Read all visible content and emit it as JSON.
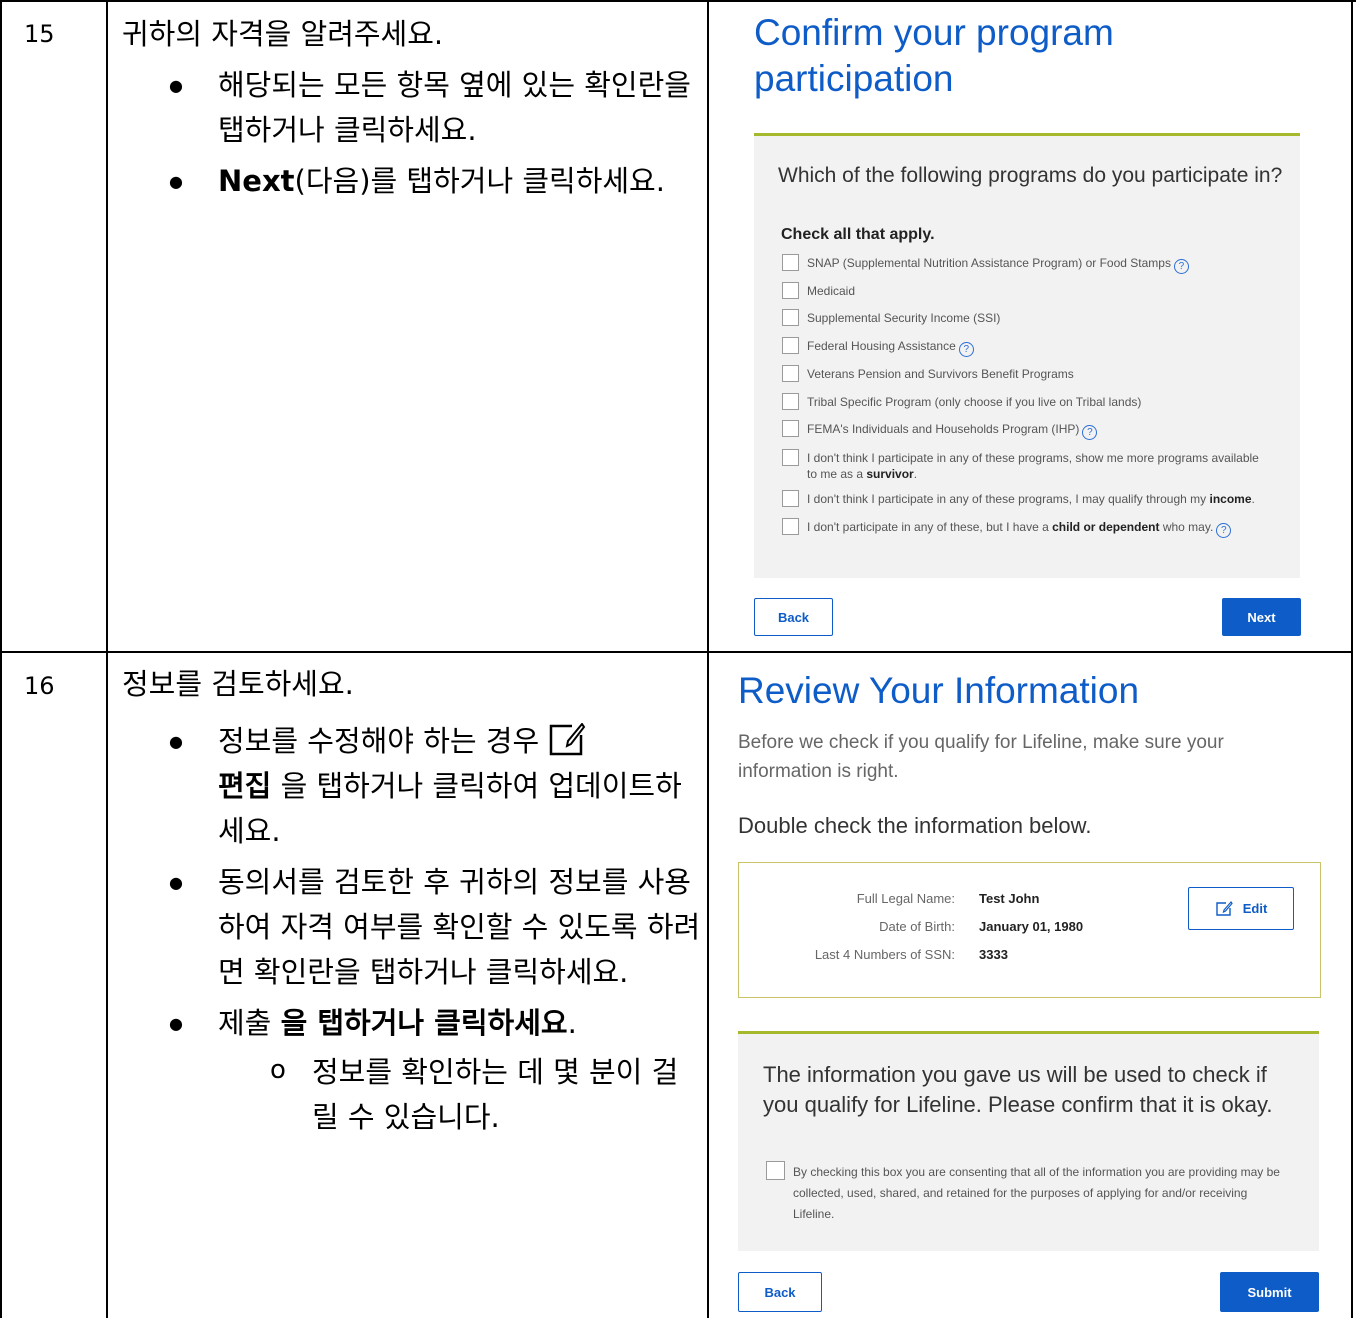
{
  "steps": [
    {
      "number": "15",
      "heading": "귀하의 자격을 알려주세요.",
      "bullet1": "해당되는 모든 항목 옆에 있는 확인란을 탭하거나 클릭하세요.",
      "bullet2_bold": "Next",
      "bullet2_rest": "(다음)를 탭하거나 클릭하세요."
    },
    {
      "number": "16",
      "heading": "정보를 검토하세요.",
      "bullet1_a": "정보를 수정해야 하는 경우",
      "bullet1_bold": "편집",
      "bullet1_b": "을 탭하거나 클릭하여 업데이트하세요.",
      "bullet2": "동의서를 검토한 후 귀하의 정보를 사용하여 자격 여부를 확인할 수 있도록 하려면 확인란을 탭하거나 클릭하세요.",
      "bullet3_a": "제출",
      "bullet3_bold": "을 탭하거나 클릭하세요",
      "bullet3_b": ".",
      "sub_bullet": "정보를 확인하는 데 몇 분이 걸릴 수 있습니다."
    }
  ],
  "screen1": {
    "title": "Confirm your program participation",
    "question": "Which of the following programs do you participate in?",
    "check_all": "Check all that apply.",
    "options": [
      {
        "text": "SNAP (Supplemental Nutrition Assistance Program) or Food Stamps",
        "help": "?"
      },
      {
        "text": "Medicaid"
      },
      {
        "text": "Supplemental Security Income (SSI)"
      },
      {
        "text": "Federal Housing Assistance",
        "help": "?"
      },
      {
        "text": "Veterans Pension and Survivors Benefit Programs"
      },
      {
        "text": "Tribal Specific Program (only choose if you live on Tribal lands)"
      },
      {
        "text": "FEMA's Individuals and Households Program (IHP)",
        "help": "?"
      }
    ],
    "opt_survivor_a": "I don't think I participate in any of these programs, show me more programs available to me as a",
    "opt_survivor_bold": "survivor",
    "opt_survivor_b": ".",
    "opt_income_a": "I don't think I participate in any of these programs, I may qualify through my",
    "opt_income_bold": "income",
    "opt_income_b": ".",
    "opt_child_a": "I don't participate in any of these, but I have a",
    "opt_child_bold": "child or dependent",
    "opt_child_b": "who may.",
    "help_glyph": "?",
    "back_label": "Back",
    "next_label": "Next"
  },
  "screen2": {
    "title": "Review Your Information",
    "subtitle": "Before we check if you qualify for Lifeline, make sure your information is right.",
    "double_check": "Double check the information below.",
    "fields": [
      {
        "label": "Full Legal Name:",
        "value": "Test John"
      },
      {
        "label": "Date of Birth:",
        "value": "January 01, 1980"
      },
      {
        "label": "Last 4 Numbers of SSN:",
        "value": "3333"
      }
    ],
    "edit_label": "Edit",
    "consent_heading": "The information you gave us will be used to check if you qualify for Lifeline. Please confirm that it is okay.",
    "consent_text": "By checking this box you are consenting that all of the information you are providing may be collected, used, shared, and retained for the purposes of applying for and/or receiving Lifeline.",
    "back_label": "Back",
    "submit_label": "Submit"
  },
  "colors": {
    "accent_blue": "#0e5cc7",
    "divider_green": "#a6b82b",
    "panel_gray": "#f2f2f2"
  }
}
